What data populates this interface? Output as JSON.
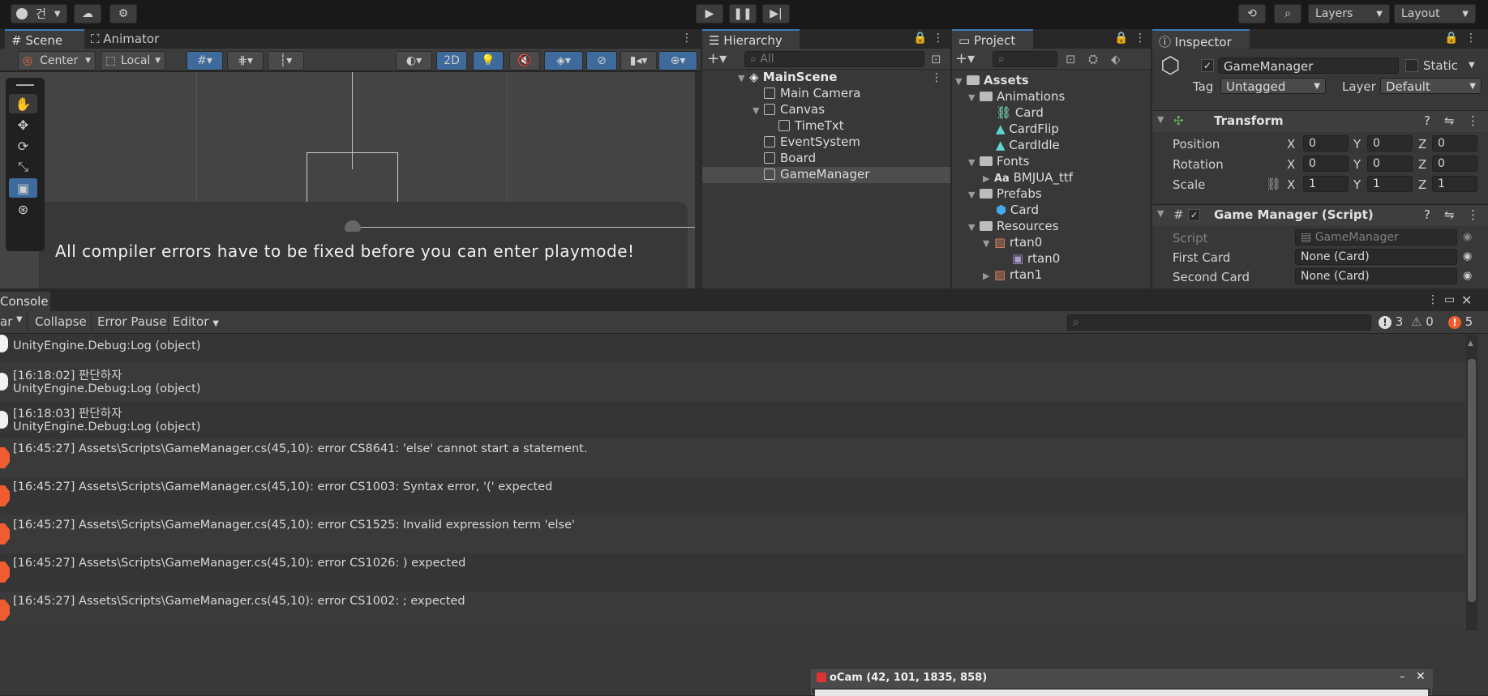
{
  "toolbar": {
    "account_label": "건",
    "layers_label": "Layers",
    "layout_label": "Layout"
  },
  "scene": {
    "tab_scene": "Scene",
    "tab_animator": "Animator",
    "pivot_label": "Center",
    "space_label": "Local",
    "mode_2d": "2D",
    "error_message": "All compiler errors have to be fixed before you can enter playmode!"
  },
  "hierarchy": {
    "tab": "Hierarchy",
    "search_placeholder": "All",
    "scene_name": "MainScene",
    "items": [
      "Main Camera",
      "Canvas",
      "TimeTxt",
      "EventSystem",
      "Board",
      "GameManager"
    ]
  },
  "project": {
    "tab": "Project",
    "root": "Assets",
    "items": [
      "Animations",
      "Card",
      "CardFlip",
      "CardIdle",
      "Fonts",
      "BMJUA_ttf",
      "Prefabs",
      "Card",
      "Resources",
      "rtan0",
      "rtan0",
      "rtan1"
    ]
  },
  "inspector": {
    "tab": "Inspector",
    "object_name": "GameManager",
    "static_label": "Static",
    "tag_label": "Tag",
    "tag_value": "Untagged",
    "layer_label": "Layer",
    "layer_value": "Default",
    "transform_title": "Transform",
    "position_label": "Position",
    "rotation_label": "Rotation",
    "scale_label": "Scale",
    "axis_x": "X",
    "axis_y": "Y",
    "axis_z": "Z",
    "position": [
      "0",
      "0",
      "0"
    ],
    "rotation": [
      "0",
      "0",
      "0"
    ],
    "scale": [
      "1",
      "1",
      "1"
    ],
    "script_component_title": "Game Manager (Script)",
    "script_label": "Script",
    "script_value": "GameManager",
    "first_card_label": "First Card",
    "first_card_value": "None (Card)",
    "second_card_label": "Second Card",
    "second_card_value": "None (Card)"
  },
  "console": {
    "tab": "Console",
    "clear_label": "ar",
    "collapse_label": "Collapse",
    "error_pause_label": "Error Pause",
    "editor_label": "Editor",
    "count_info": "3",
    "count_warn": "0",
    "count_error": "5",
    "logs": [
      {
        "line1": "",
        "line2": "UnityEngine.Debug:Log (object)",
        "type": "log"
      },
      {
        "line1": "[16:18:02] 판단하자",
        "line2": "UnityEngine.Debug:Log (object)",
        "type": "log"
      },
      {
        "line1": "[16:18:03] 판단하자",
        "line2": "UnityEngine.Debug:Log (object)",
        "type": "log"
      },
      {
        "line1": "[16:45:27] Assets\\Scripts\\GameManager.cs(45,10): error CS8641: 'else' cannot start a statement.",
        "line2": "",
        "type": "error"
      },
      {
        "line1": "[16:45:27] Assets\\Scripts\\GameManager.cs(45,10): error CS1003: Syntax error, '(' expected",
        "line2": "",
        "type": "error"
      },
      {
        "line1": "[16:45:27] Assets\\Scripts\\GameManager.cs(45,10): error CS1525: Invalid expression term 'else'",
        "line2": "",
        "type": "error"
      },
      {
        "line1": "[16:45:27] Assets\\Scripts\\GameManager.cs(45,10): error CS1026: ) expected",
        "line2": "",
        "type": "error"
      },
      {
        "line1": "[16:45:27] Assets\\Scripts\\GameManager.cs(45,10): error CS1002: ; expected",
        "line2": "",
        "type": "error"
      }
    ]
  },
  "ocam": {
    "title": "oCam (42, 101, 1835, 858)"
  }
}
